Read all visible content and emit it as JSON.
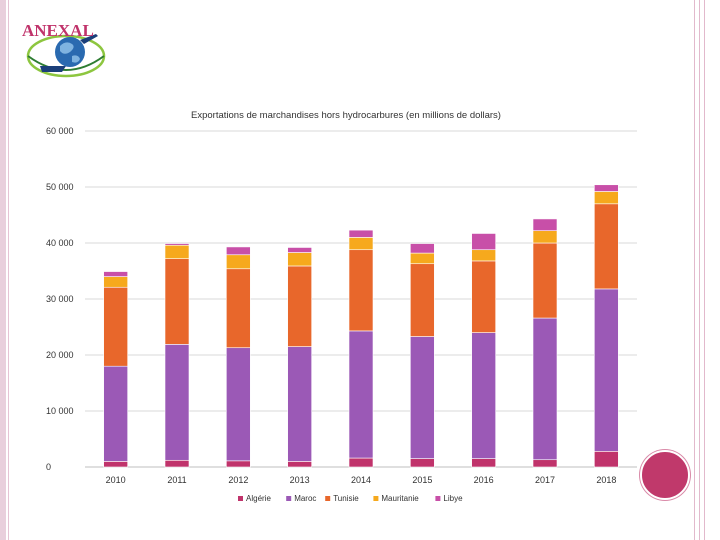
{
  "logo": {
    "text": "ANEXAL"
  },
  "colors": {
    "frame": "#e9cfdc",
    "accent_circle": "#c0396b",
    "gridline": "#d9d9d9"
  },
  "chart_data": {
    "type": "bar",
    "stacked": true,
    "title": "Exportations de marchandises hors hydrocarbures (en millions de dollars)",
    "categories": [
      "2010",
      "2011",
      "2012",
      "2013",
      "2014",
      "2015",
      "2016",
      "2017",
      "2018"
    ],
    "ylim": [
      0,
      60000
    ],
    "yticks": [
      0,
      10000,
      20000,
      30000,
      40000,
      50000,
      60000
    ],
    "ytick_labels": [
      "0",
      "10 000",
      "20 000",
      "30 000",
      "40 000",
      "50 000",
      "60 000"
    ],
    "grid": true,
    "legend_position": "bottom",
    "series": [
      {
        "name": "Algérie",
        "color": "#c0336b",
        "values": [
          1000,
          1200,
          1100,
          1000,
          1600,
          1500,
          1500,
          1300,
          2800
        ]
      },
      {
        "name": "Maroc",
        "color": "#9b59b6",
        "values": [
          17000,
          20700,
          20200,
          20500,
          22700,
          21800,
          22500,
          25300,
          29000
        ]
      },
      {
        "name": "Tunisie",
        "color": "#e8672b",
        "values": [
          14100,
          15300,
          14100,
          14400,
          14500,
          13000,
          12800,
          13400,
          15200
        ]
      },
      {
        "name": "Mauritanie",
        "color": "#f6a91d",
        "values": [
          1900,
          2400,
          2500,
          2400,
          2200,
          1900,
          2000,
          2200,
          2200
        ]
      },
      {
        "name": "Libye",
        "color": "#c84fa8",
        "values": [
          900,
          300,
          1400,
          900,
          1300,
          1700,
          2900,
          2100,
          1200
        ]
      }
    ]
  }
}
